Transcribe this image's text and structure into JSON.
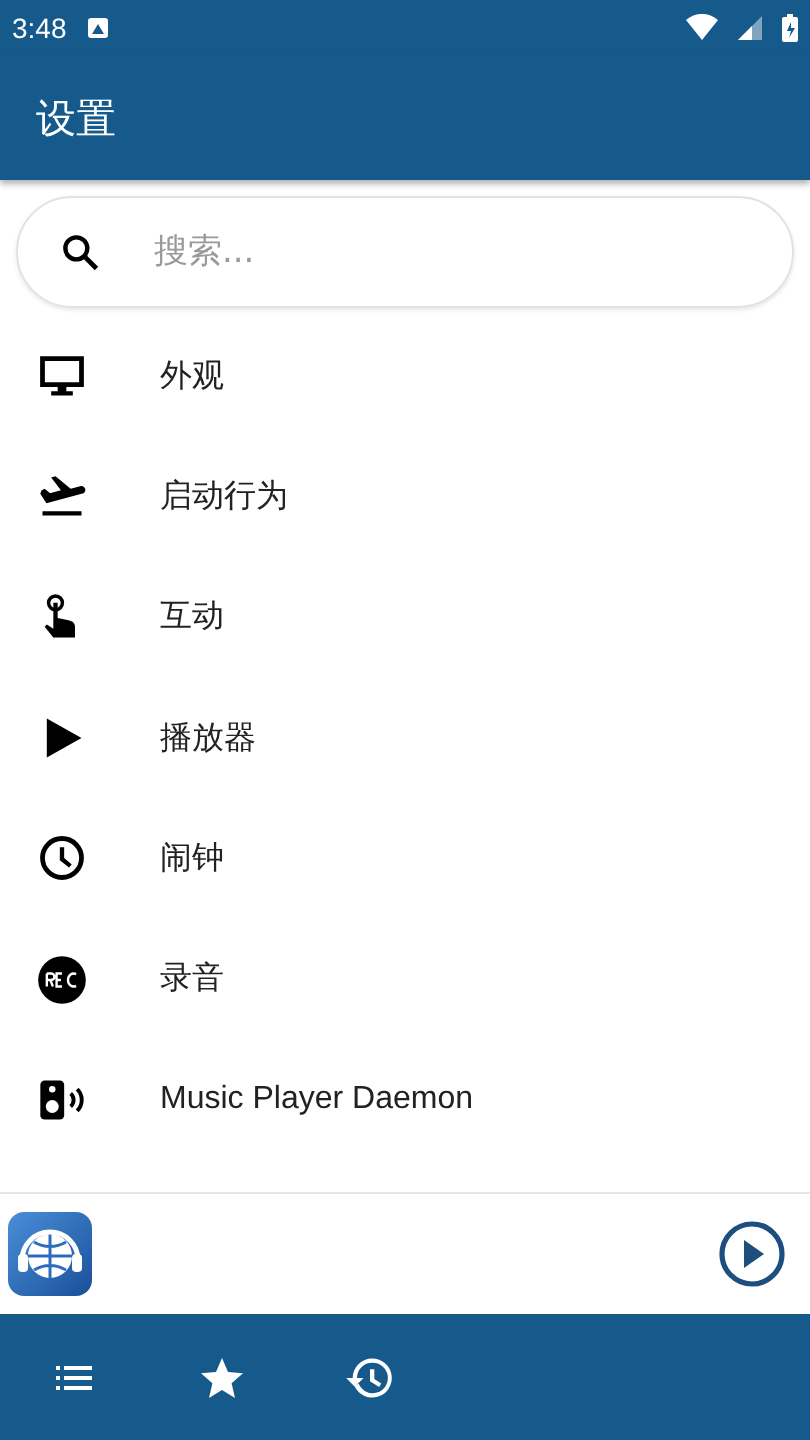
{
  "status_bar": {
    "time": "3:48"
  },
  "app_bar": {
    "title": "设置"
  },
  "search": {
    "placeholder": "搜索..."
  },
  "settings": [
    {
      "label": "外观"
    },
    {
      "label": "启动行为"
    },
    {
      "label": "互动"
    },
    {
      "label": "播放器"
    },
    {
      "label": "闹钟"
    },
    {
      "label": "录音"
    },
    {
      "label": "Music Player Daemon"
    }
  ],
  "bottom_nav": [
    {
      "selected": false
    },
    {
      "selected": false
    },
    {
      "selected": false
    }
  ]
}
